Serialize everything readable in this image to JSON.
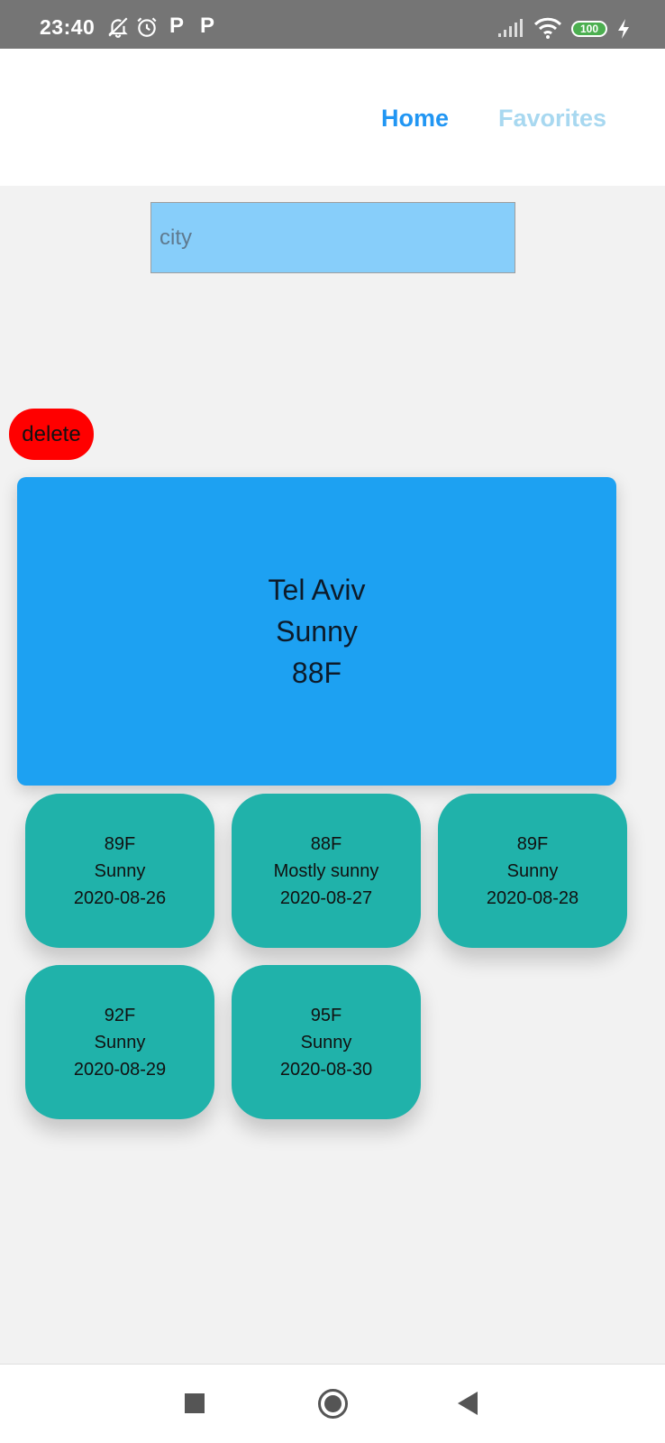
{
  "status_bar": {
    "time": "23:40",
    "icons": [
      "bell-off-icon",
      "alarm-icon",
      "p-icon",
      "p-icon",
      "signal-icon",
      "wifi-icon",
      "battery-icon",
      "charging-icon"
    ],
    "p1": "P",
    "p2": "P",
    "battery": "100"
  },
  "nav": {
    "home_label": "Home",
    "favorites_label": "Favorites",
    "active_color": "#2196f3",
    "inactive_color": "#a8d8f0"
  },
  "search": {
    "placeholder": "city",
    "value": ""
  },
  "delete_label": "delete",
  "current": {
    "city": "Tel Aviv",
    "condition": "Sunny",
    "temperature": "88F",
    "card_color": "#1da1f2"
  },
  "forecast": [
    {
      "temp": "89F",
      "condition": "Sunny",
      "date": "2020-08-26"
    },
    {
      "temp": "88F",
      "condition": "Mostly sunny",
      "date": "2020-08-27"
    },
    {
      "temp": "89F",
      "condition": "Sunny",
      "date": "2020-08-28"
    },
    {
      "temp": "92F",
      "condition": "Sunny",
      "date": "2020-08-29"
    },
    {
      "temp": "95F",
      "condition": "Sunny",
      "date": "2020-08-30"
    }
  ],
  "forecast_card_color": "#20b2aa",
  "delete_color": "#ff0000",
  "system_nav": [
    "recents-icon",
    "home-icon",
    "back-icon"
  ]
}
